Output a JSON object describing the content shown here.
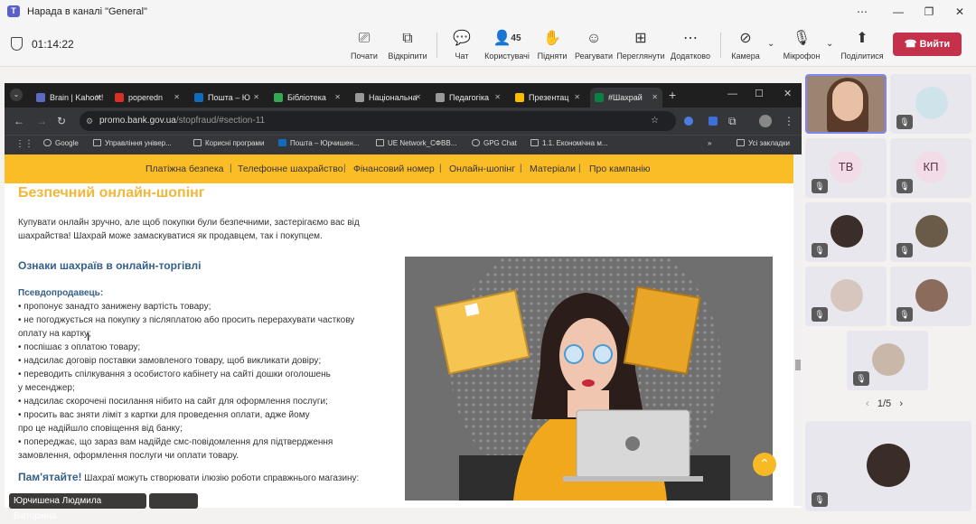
{
  "window": {
    "title": "Нарада в каналі \"General\"",
    "app_icon": "teams-icon",
    "controls": [
      "more-icon",
      "minimize-icon",
      "maximize-icon",
      "close-icon"
    ]
  },
  "meeting": {
    "timer": "01:14:22",
    "toolbar": [
      {
        "label": "Почати",
        "icon": "start-icon"
      },
      {
        "label": "Відкріпити",
        "icon": "unpin-icon"
      },
      {
        "label": "Чат",
        "icon": "chat-icon"
      },
      {
        "label": "Користувачі",
        "icon": "people-icon",
        "count": "45"
      },
      {
        "label": "Підняти",
        "icon": "raise-hand-icon"
      },
      {
        "label": "Реагувати",
        "icon": "react-icon"
      },
      {
        "label": "Переглянути",
        "icon": "view-icon"
      },
      {
        "label": "Додатково",
        "icon": "more-icon"
      },
      {
        "label": "Камера",
        "icon": "camera-off-icon"
      },
      {
        "label": "Мікрофон",
        "icon": "mic-off-icon"
      },
      {
        "label": "Поділитися",
        "icon": "share-icon"
      }
    ],
    "leave_label": "Вийти",
    "accent": "#c4314b"
  },
  "browser": {
    "tabs": [
      {
        "label": "Brain | Kahoot!",
        "color": "#5c6bc0"
      },
      {
        "label": "poperedn",
        "color": "#d93025"
      },
      {
        "label": "Пошта – Ю",
        "color": "#0f6cbd"
      },
      {
        "label": "Бібліотека",
        "color": "#34a853"
      },
      {
        "label": "Національна",
        "color": "#999999"
      },
      {
        "label": "Педагогіка",
        "color": "#999999"
      },
      {
        "label": "Презентац",
        "color": "#fbbc04"
      },
      {
        "label": "#Шахрай",
        "color": "#0b8043",
        "active": true
      }
    ],
    "url_host": "promo.bank.gov.ua",
    "url_path": "/stopfraud/#section-11",
    "bookmarks": [
      "Google",
      "Управління універ...",
      "Корисні програми",
      "Пошта – Юрчишен...",
      "UE Network_СФВВ...",
      "GPG Chat",
      "1.1. Економічна м...",
      "Усі закладки"
    ]
  },
  "site": {
    "nav": [
      "Платіжна безпека",
      "Телефонне шахрайство",
      "Фінансовий номер",
      "Онлайн-шопінг",
      "Матеріали",
      "Про кампанію"
    ],
    "heading": "Безпечний онлайн-шопінг",
    "intro_1": "Купувати онлайн зручно, але щоб покупки були безпечними, застерігаємо вас від",
    "intro_2": "шахрайства! Шахрай може замаскуватися як продавцем, так і покупцем.",
    "subheading": "Ознаки шахраїв в онлайн-торгівлі",
    "fake_seller": "Псевдопродавець:",
    "bullets": [
      "•  пропонує занадто занижену вартість товару;",
      "•  не погоджується на покупку з післяплатою або просить перерахувати часткову",
      "оплату на картку;",
      "•  поспішає з оплатою товару;",
      "•  надсилає договір поставки замовленого товару, щоб викликати довіру;",
      "•  переводить спілкування з особистого кабінету на сайті дошки оголошень",
      "у месенджер;",
      "•  надсилає скорочені посилання нібито на сайт для оформлення послуги;",
      "•  просить вас зняти ліміт з картки для проведення оплати, адже йому",
      "про це надійшло сповіщення від банку;",
      "•  попереджає, що зараз вам надійде смс-повідомлення для підтвердження",
      "замовлення, оформлення послуги чи оплати товару."
    ],
    "remember_label": "Пам'ятайте!",
    "remember_text": "Шахраї можуть створювати ілюзію роботи справжнього магазину:",
    "brand_yellow": "#fbbd26"
  },
  "presenter_name": "Юрчишена Людмила Вікторівна",
  "participants": [
    {
      "type": "video",
      "tone": "#b99a86",
      "active": true
    },
    {
      "type": "avatar",
      "tone": "#cfe4ea",
      "muted": true
    },
    {
      "type": "initials",
      "initials": "ТВ",
      "muted": true
    },
    {
      "type": "initials",
      "initials": "КП",
      "muted": true
    },
    {
      "type": "avatar",
      "tone": "#3b2d2a",
      "muted": true
    },
    {
      "type": "avatar",
      "tone": "#6a5a48",
      "muted": true
    },
    {
      "type": "avatar",
      "tone": "#d7c6bd",
      "muted": true
    },
    {
      "type": "avatar",
      "tone": "#8a6b5c",
      "muted": true
    },
    {
      "type": "avatar",
      "tone": "#c9b8aa",
      "muted": true
    },
    {
      "type": "avatar",
      "tone": "#3a2d28",
      "muted": true
    }
  ],
  "pager": "1/5"
}
